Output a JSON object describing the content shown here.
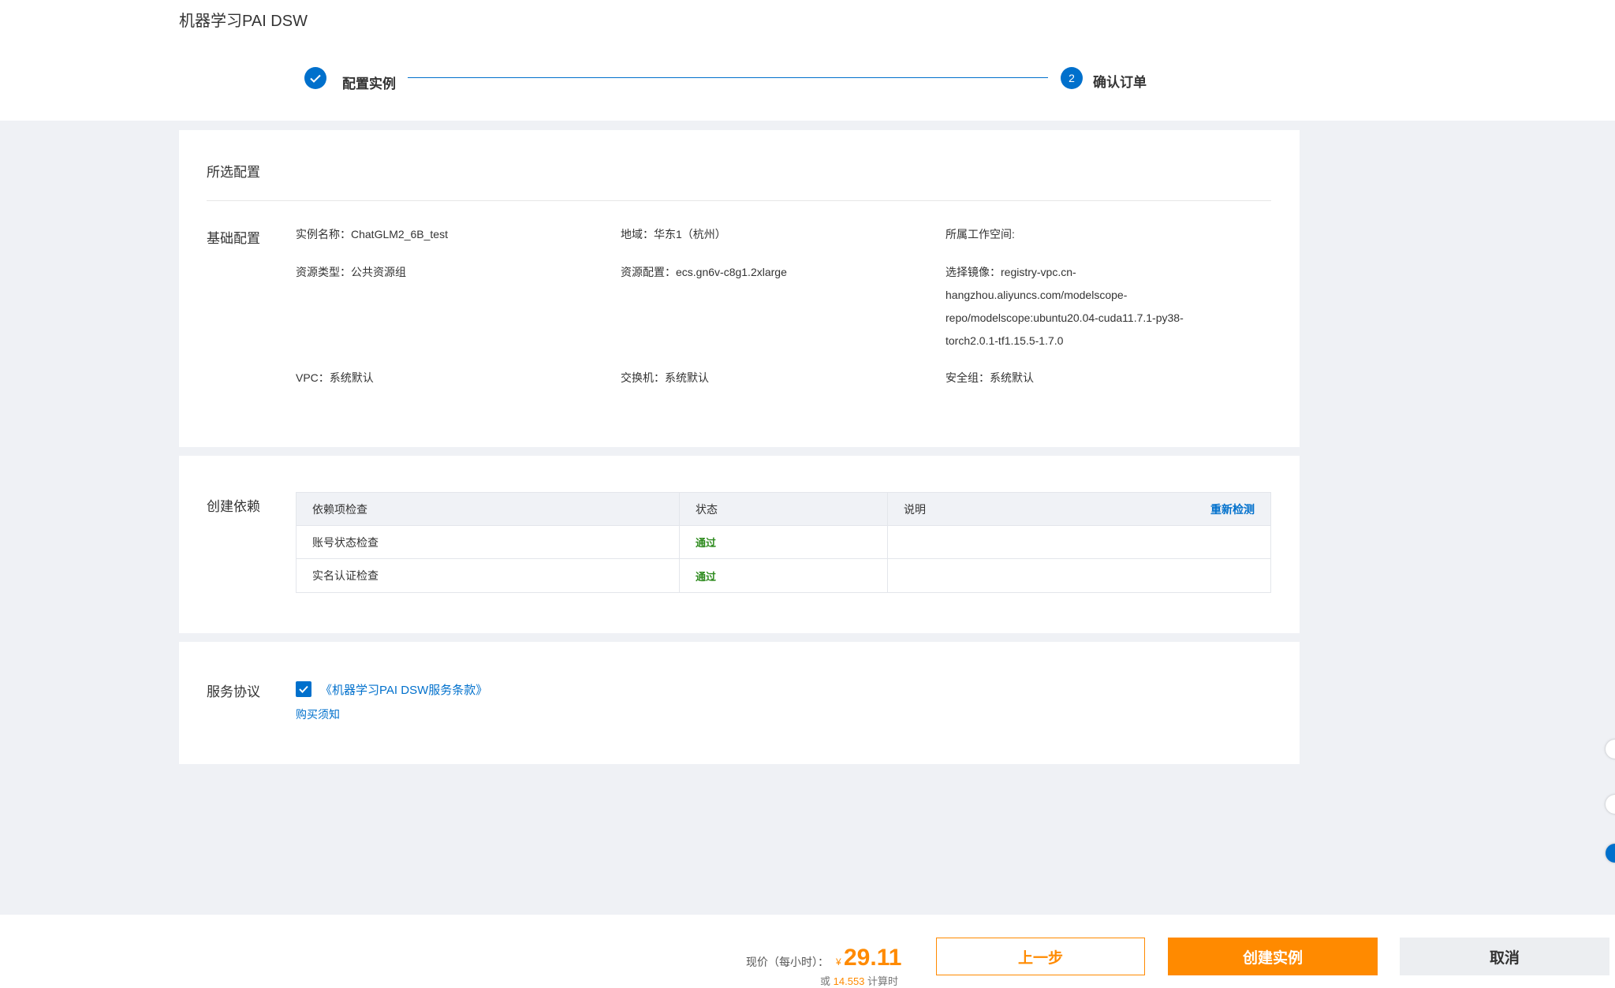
{
  "app_title": "机器学习PAI DSW",
  "steps": [
    {
      "label": "配置实例",
      "state": "done"
    },
    {
      "label": "确认订单",
      "state": "current",
      "number": "2"
    }
  ],
  "selected_config": {
    "section_title": "所选配置",
    "basic": {
      "title": "基础配置",
      "instance_name_key": "实例名称：",
      "instance_name_val": "ChatGLM2_6B_test",
      "region_key": "地域：",
      "region_val": "华东1（杭州）",
      "workspace_key": "所属工作空间:",
      "workspace_val": "",
      "resource_type_key": "资源类型：",
      "resource_type_val": "公共资源组",
      "resource_config_key": "资源配置：",
      "resource_config_val": "ecs.gn6v-c8g1.2xlarge",
      "image_key": "选择镜像：",
      "image_line1": "registry-vpc.cn-",
      "image_line2": "hangzhou.aliyuncs.com/modelscope-",
      "image_line3": "repo/modelscope:ubuntu20.04-cuda11.7.1-py38-",
      "image_line4": "torch2.0.1-tf1.15.5-1.7.0",
      "vpc_key": "VPC：",
      "vpc_val": "系统默认",
      "switch_key": "交换机：",
      "switch_val": "系统默认",
      "security_key": "安全组：",
      "security_val": "系统默认"
    }
  },
  "dependencies": {
    "title": "创建依赖",
    "headers": [
      "依赖项检查",
      "状态",
      "说明"
    ],
    "recheck_label": "重新检测",
    "rows": [
      {
        "item": "账号状态检查",
        "status": "通过",
        "note": ""
      },
      {
        "item": "实名认证检查",
        "status": "通过",
        "note": ""
      }
    ]
  },
  "agreement": {
    "title": "服务协议",
    "checked": true,
    "terms_link": "《机器学习PAI DSW服务条款》",
    "purchase_notice": "购买须知"
  },
  "footer": {
    "price_label": "现价（每小时）：",
    "currency": "¥",
    "price": "29.11",
    "alt_prefix": "或",
    "alt_value": "14.553",
    "alt_suffix": "计算时",
    "prev_button": "上一步",
    "create_button": "创建实例",
    "cancel_button": "取消"
  },
  "colors": {
    "primary": "#0070cc",
    "accent": "#ff8a00",
    "success": "#2e8b1e",
    "page_bg": "#eff1f5"
  }
}
